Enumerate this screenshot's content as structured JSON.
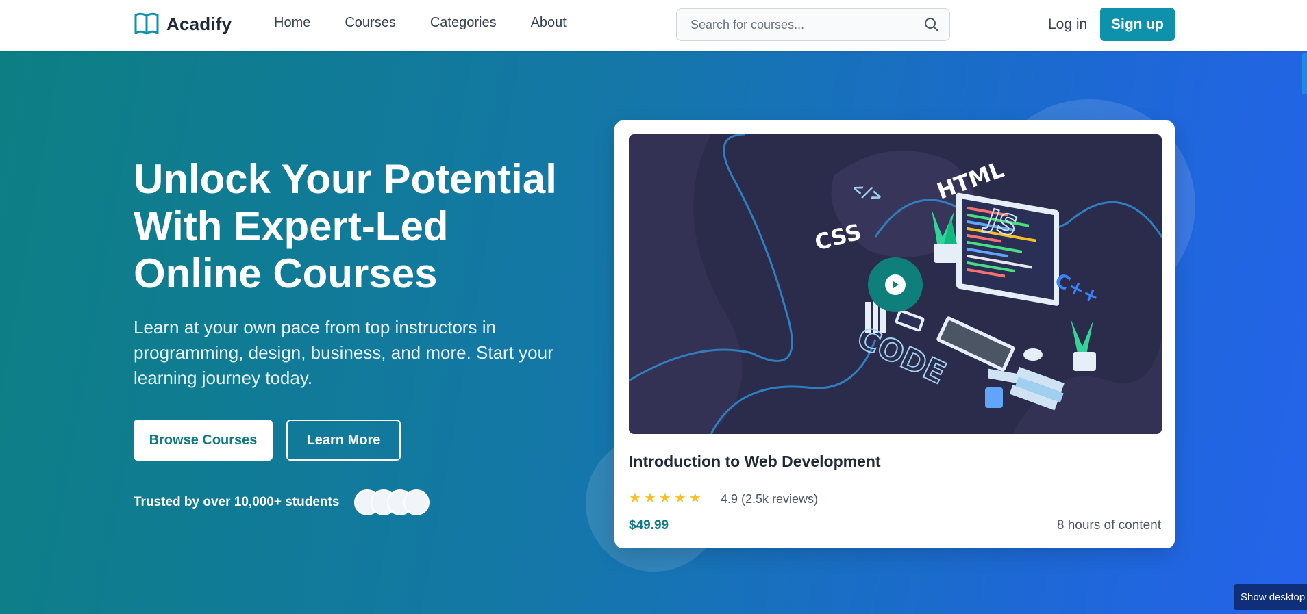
{
  "brand": {
    "name": "Acadify",
    "accent": "#0e92ac"
  },
  "nav": {
    "items": [
      {
        "label": "Home"
      },
      {
        "label": "Courses"
      },
      {
        "label": "Categories"
      },
      {
        "label": "About"
      }
    ]
  },
  "search": {
    "placeholder": "Search for courses...",
    "value": ""
  },
  "auth": {
    "login_label": "Log in",
    "signup_label": "Sign up"
  },
  "hero": {
    "title": "Unlock Your Potential With Expert-Led Online Courses",
    "subtitle": "Learn at your own pace from top instructors in programming, design, business, and more. Start your learning journey today.",
    "primary_button": "Browse Courses",
    "secondary_button": "Learn More",
    "trusted_text": "Trusted by over 10,000+ students"
  },
  "featured_course": {
    "title": "Introduction to Web Development",
    "rating_stars": 5,
    "rating_text": "4.9 (2.5k reviews)",
    "price": "$49.99",
    "duration": "8 hours of content",
    "illustration_labels": {
      "html": "HTML",
      "css": "CSS",
      "js": "JS",
      "cpp": "C++",
      "code": "CODE",
      "tag": "</>"
    }
  },
  "system": {
    "show_desktop_label": "Show desktop"
  }
}
